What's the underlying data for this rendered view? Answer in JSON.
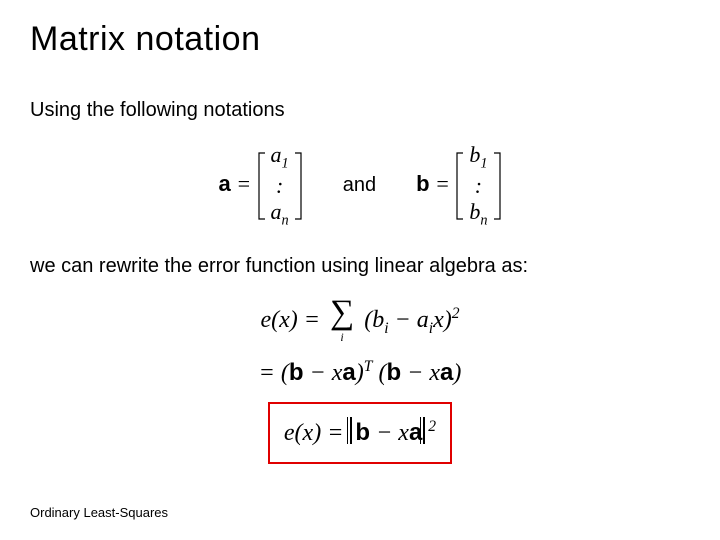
{
  "title": "Matrix notation",
  "intro": "Using the following notations",
  "vec_a_label": "a",
  "eq_sign": "=",
  "vec_a_entries": {
    "top": "a",
    "top_sub": "1",
    "mid": ":",
    "bot": "a",
    "bot_sub": "n"
  },
  "and_text": "and",
  "vec_b_label": "b",
  "vec_b_entries": {
    "top": "b",
    "top_sub": "1",
    "mid": ":",
    "bot": "b",
    "bot_sub": "n"
  },
  "rewrite_text": "we can rewrite the error function using linear algebra as:",
  "eq1": {
    "lhs_e": "e",
    "lhs_paren_open": "(",
    "lhs_var": "x",
    "lhs_paren_close": ")",
    "eq": "=",
    "sum_idx": "i",
    "open": "(",
    "bi": "b",
    "bi_sub": "i",
    "minus": " − ",
    "ai": "a",
    "ai_sub": "i",
    "x": "x",
    "close": ")",
    "sq": "2"
  },
  "eq2": {
    "eq": "=",
    "open1": "(",
    "b": "b",
    "minus1": " − ",
    "x1": "x",
    "a1": "a",
    "close1": ")",
    "T": "T",
    "open2": "(",
    "b2": "b",
    "minus2": " − ",
    "x2": "x",
    "a2": "a",
    "close2": ")"
  },
  "eq3": {
    "lhs_e": "e",
    "lhs_paren_open": "(",
    "lhs_var": "x",
    "lhs_paren_close": ")",
    "eq": "=",
    "b": "b",
    "minus": " − ",
    "x": "x",
    "a": "a",
    "sq": "2"
  },
  "footer": "Ordinary Least-Squares"
}
